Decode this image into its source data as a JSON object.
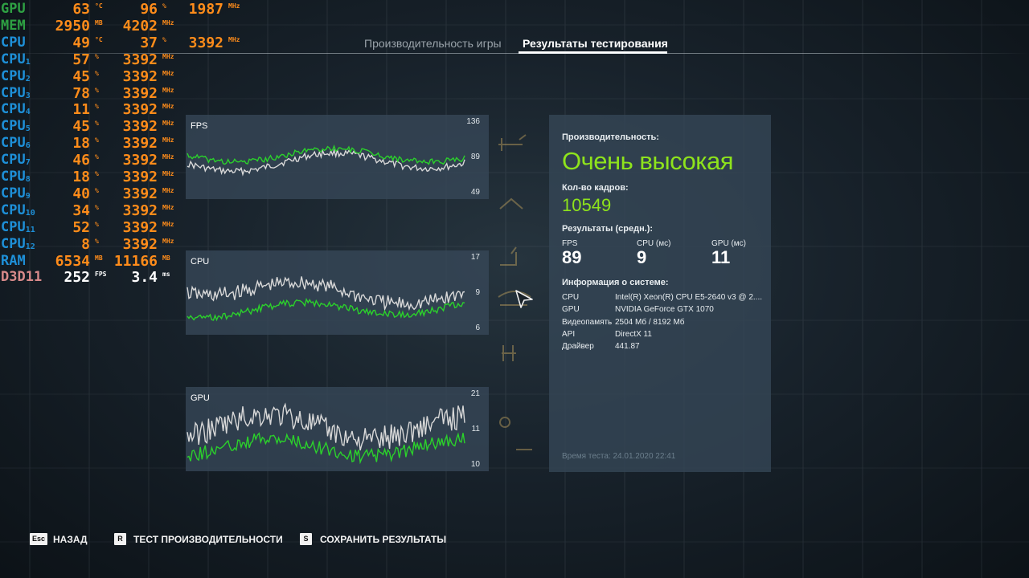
{
  "osd": {
    "rows": [
      {
        "label": "GPU",
        "v1": "63",
        "u1": "°C",
        "v2": "96",
        "u2": "%",
        "v3": "1987",
        "u3": "MHz",
        "color": "gpu"
      },
      {
        "label": "MEM",
        "v1": "2950",
        "u1": "MB",
        "v2": "4202",
        "u2": "MHz",
        "color": "mem"
      },
      {
        "label": "CPU",
        "v1": "49",
        "u1": "°C",
        "v2": "37",
        "u2": "%",
        "v3": "3392",
        "u3": "MHz",
        "color": "cpu"
      },
      {
        "label": "CPU",
        "sub": "1",
        "v1": "57",
        "u1": "%",
        "v2": "3392",
        "u2": "MHz",
        "color": "cpu"
      },
      {
        "label": "CPU",
        "sub": "2",
        "v1": "45",
        "u1": "%",
        "v2": "3392",
        "u2": "MHz",
        "color": "cpu"
      },
      {
        "label": "CPU",
        "sub": "3",
        "v1": "78",
        "u1": "%",
        "v2": "3392",
        "u2": "MHz",
        "color": "cpu"
      },
      {
        "label": "CPU",
        "sub": "4",
        "v1": "11",
        "u1": "%",
        "v2": "3392",
        "u2": "MHz",
        "color": "cpu"
      },
      {
        "label": "CPU",
        "sub": "5",
        "v1": "45",
        "u1": "%",
        "v2": "3392",
        "u2": "MHz",
        "color": "cpu"
      },
      {
        "label": "CPU",
        "sub": "6",
        "v1": "18",
        "u1": "%",
        "v2": "3392",
        "u2": "MHz",
        "color": "cpu"
      },
      {
        "label": "CPU",
        "sub": "7",
        "v1": "46",
        "u1": "%",
        "v2": "3392",
        "u2": "MHz",
        "color": "cpu"
      },
      {
        "label": "CPU",
        "sub": "8",
        "v1": "18",
        "u1": "%",
        "v2": "3392",
        "u2": "MHz",
        "color": "cpu"
      },
      {
        "label": "CPU",
        "sub": "9",
        "v1": "40",
        "u1": "%",
        "v2": "3392",
        "u2": "MHz",
        "color": "cpu"
      },
      {
        "label": "CPU",
        "sub": "10",
        "v1": "34",
        "u1": "%",
        "v2": "3392",
        "u2": "MHz",
        "color": "cpu"
      },
      {
        "label": "CPU",
        "sub": "11",
        "v1": "52",
        "u1": "%",
        "v2": "3392",
        "u2": "MHz",
        "color": "cpu"
      },
      {
        "label": "CPU",
        "sub": "12",
        "v1": "8",
        "u1": "%",
        "v2": "3392",
        "u2": "MHz",
        "color": "cpu"
      },
      {
        "label": "RAM",
        "v1": "6534",
        "u1": "MB",
        "v2": "11166",
        "u2": "MB",
        "color": "ram"
      },
      {
        "label": "D3D11",
        "v1": "252",
        "u1": "FPS",
        "v2": "3.4",
        "u2": "ms",
        "color": "d3d"
      }
    ],
    "colors": {
      "gpu": "#2ea043",
      "mem": "#2ea043",
      "cpu": "#1e90d8",
      "ram": "#1e90d8",
      "d3d": "#d88a8a",
      "value": "#ff8c1a"
    }
  },
  "tabs": {
    "game": "Производительность игры",
    "results": "Результаты тестирования"
  },
  "graphs": [
    {
      "title": "FPS",
      "ticks": [
        "136",
        "89",
        "49"
      ],
      "min": 49,
      "max": 136
    },
    {
      "title": "CPU",
      "ticks": [
        "17",
        "9",
        "6"
      ],
      "min": 6,
      "max": 17
    },
    {
      "title": "GPU",
      "ticks": [
        "21",
        "11",
        "10"
      ],
      "min": 10,
      "max": 21
    }
  ],
  "series_colors": {
    "current": "#2bd12b",
    "reference": "#d8d8d8"
  },
  "panel": {
    "perf_label": "Производительность:",
    "perf_value": "Очень высокая",
    "frames_label": "Кол-во кадров:",
    "frames_value": "10549",
    "avg_label": "Результаты (средн.):",
    "avg": [
      {
        "head": "FPS",
        "value": "89"
      },
      {
        "head": "CPU (мс)",
        "value": "9"
      },
      {
        "head": "GPU (мс)",
        "value": "11"
      }
    ],
    "sys_label": "Информация о системе:",
    "sys": [
      {
        "k": "CPU",
        "v": "Intel(R) Xeon(R) CPU E5-2640 v3 @ 2...."
      },
      {
        "k": "GPU",
        "v": "NVIDIA GeForce GTX 1070"
      },
      {
        "k": "Видеопамять",
        "v": "2504 Мб / 8192 Мб"
      },
      {
        "k": "API",
        "v": "DirectX 11"
      },
      {
        "k": "Драйвер",
        "v": "441.87"
      }
    ],
    "test_time": "Время теста: 24.01.2020 22:41",
    "accent": "#8ee31c"
  },
  "footer": [
    {
      "key": "Esc",
      "label": "НАЗАД"
    },
    {
      "key": "R",
      "label": "ТЕСТ ПРОИЗВОДИТЕЛЬНОСТИ"
    },
    {
      "key": "S",
      "label": "СОХРАНИТЬ РЕЗУЛЬТАТЫ"
    }
  ]
}
